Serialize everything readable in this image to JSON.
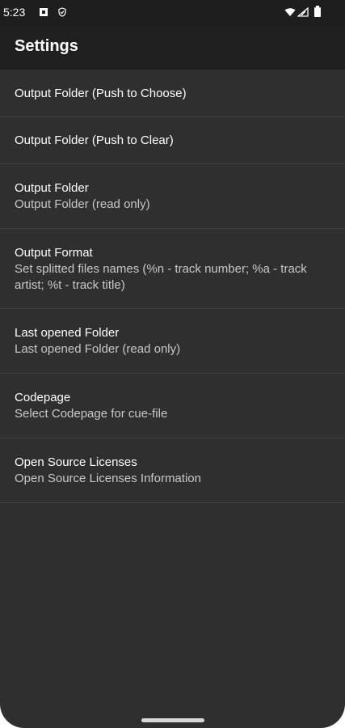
{
  "status_bar": {
    "time": "5:23",
    "icons": [
      "notification-square-icon",
      "shield-icon",
      "wifi-icon",
      "signal-icon",
      "battery-icon"
    ]
  },
  "toolbar": {
    "title": "Settings"
  },
  "settings": [
    {
      "title": "Output Folder (Push to Choose)",
      "summary": ""
    },
    {
      "title": "Output Folder (Push to Clear)",
      "summary": ""
    },
    {
      "title": "Output Folder",
      "summary": "Output Folder (read only)"
    },
    {
      "title": "Output Format",
      "summary": "Set splitted files names (%n - track number; %a - track artist; %t - track title)"
    },
    {
      "title": "Last opened Folder",
      "summary": "Last opened Folder (read only)"
    },
    {
      "title": "Codepage",
      "summary": "Select Codepage for cue-file"
    },
    {
      "title": "Open Source Licenses",
      "summary": "Open Source Licenses Information"
    }
  ],
  "colors": {
    "background": "#2f2f2f",
    "toolbar": "#1f1f1f",
    "text_primary": "#ffffff",
    "text_secondary": "#c8c8c8",
    "divider": "#3f3f3f"
  }
}
